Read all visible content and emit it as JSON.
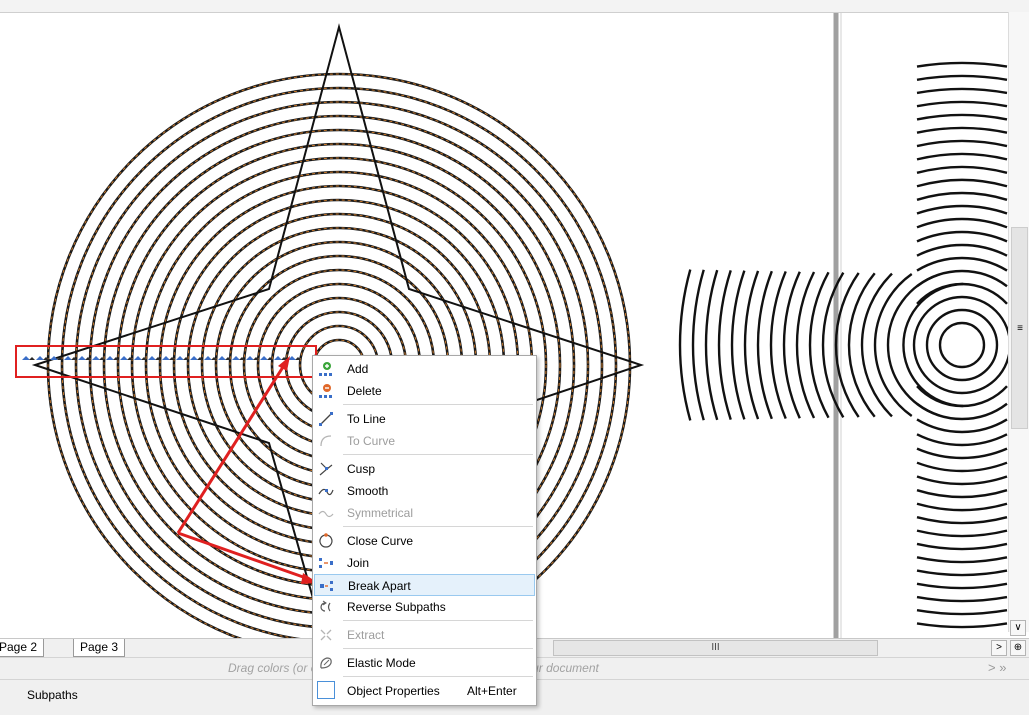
{
  "page_tabs": [
    "Page 2",
    "Page 3"
  ],
  "palette_hint": "Drag colors (or objects) here to store these colors with your document",
  "status_text": "Subpaths",
  "hscroll_grip": "III",
  "vscroll_grip": "≡",
  "corner_buttons": {
    "next": ">",
    "zoom": "⊕",
    "scroll_down": "∨"
  },
  "palette_arrows": "> »",
  "context_menu": {
    "add": "Add",
    "delete": "Delete",
    "to_line": "To Line",
    "to_curve": "To Curve",
    "cusp": "Cusp",
    "smooth": "Smooth",
    "symmetrical": "Symmetrical",
    "close_curve": "Close Curve",
    "join": "Join",
    "break_apart": "Break Apart",
    "reverse_subpaths": "Reverse Subpaths",
    "extract": "Extract",
    "elastic_mode": "Elastic Mode",
    "object_properties": "Object Properties",
    "object_properties_shortcut": "Alt+Enter"
  },
  "colors": {
    "annotation": "#e02020",
    "ring_outline": "#1a1a1a",
    "ring_dash": "#c8782a",
    "menu_highlight": "#e5f1fb"
  },
  "icons": {
    "add": "add-node-icon",
    "delete": "delete-node-icon",
    "to_line": "to-line-icon",
    "to_curve": "to-curve-icon",
    "cusp": "cusp-icon",
    "smooth": "smooth-icon",
    "symmetrical": "symmetrical-icon",
    "close_curve": "close-curve-icon",
    "join": "join-icon",
    "break_apart": "break-apart-icon",
    "reverse_subpaths": "reverse-subpaths-icon",
    "extract": "extract-icon",
    "elastic_mode": "elastic-mode-icon",
    "object_properties": "object-properties-icon"
  }
}
